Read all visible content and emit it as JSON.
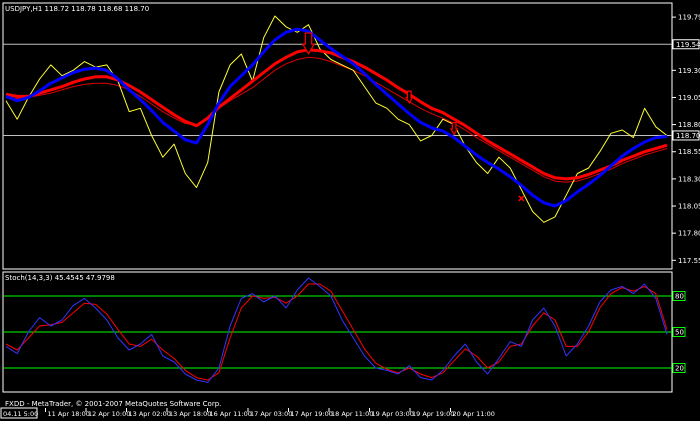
{
  "app": {
    "footer_text": "FXDD - MetaTrader, © 2001-2007 MetaQuotes Software Corp."
  },
  "colors": {
    "background": "#000000",
    "frame": "#FFFFFF",
    "grid": "#C0C0C0",
    "price": "#FFFF33",
    "ema_fast": "#0000FF",
    "ema_slow": "#FF0000",
    "signal_thin": "#DD0000",
    "stoch_main": "#3333FF",
    "stoch_signal": "#FF0000",
    "level_line": "#00FF00"
  },
  "price_chart": {
    "header": "USDJPY,H1  118.72 118.78 118.68 118.70",
    "y_ticks": [
      "119.79",
      "119.54",
      "119.30",
      "119.05",
      "118.80",
      "118.55",
      "118.30",
      "118.05",
      "117.80",
      "117.55"
    ],
    "highlight_levels": [
      "119.54",
      "118.70"
    ],
    "markers": [
      {
        "icon": "down-arrow-icon",
        "size": "large"
      },
      {
        "icon": "down-arrow-icon",
        "size": "small"
      },
      {
        "icon": "down-arrow-icon",
        "size": "small"
      },
      {
        "icon": "cross-icon",
        "size": "small"
      }
    ]
  },
  "stoch_chart": {
    "header": "Stoch(14,3,3) 45.4545 47.9798",
    "levels": [
      "80",
      "50",
      "20"
    ]
  },
  "time_axis": [
    "04.11 5:00",
    "11 Apr 18:00",
    "12 Apr 10:00",
    "13 Apr 02:00",
    "13 Apr 18:00",
    "16 Apr 11:00",
    "17 Apr 03:00",
    "17 Apr 19:00",
    "18 Apr 11:00",
    "19 Apr 03:00",
    "19 Apr 19:00",
    "20 Apr 11:00"
  ],
  "chart_data": {
    "type": "line",
    "symbol": "USDJPY",
    "timeframe": "H1",
    "last_bar": {
      "open": 118.72,
      "high": 118.78,
      "low": 118.68,
      "close": 118.7
    },
    "ylim": [
      117.47,
      119.92
    ],
    "series": [
      {
        "values": [
          119.02,
          118.85,
          119.05,
          119.22,
          119.35,
          119.25,
          119.3,
          119.38,
          119.33,
          119.35,
          119.2,
          118.92,
          118.95,
          118.7,
          118.5,
          118.62,
          118.35,
          118.22,
          118.45,
          119.1,
          119.35,
          119.45,
          119.2,
          119.6,
          119.8,
          119.7,
          119.65,
          119.72,
          119.5,
          119.4,
          119.35,
          119.3,
          119.15,
          119.0,
          118.95,
          118.85,
          118.8,
          118.65,
          118.7,
          118.85,
          118.8,
          118.6,
          118.45,
          118.35,
          118.5,
          118.4,
          118.2,
          118.0,
          117.9,
          117.95,
          118.15,
          118.35,
          118.4,
          118.55,
          118.72,
          118.75,
          118.68,
          118.95,
          118.78,
          118.7
        ]
      },
      {
        "values": [
          119.06,
          119.02,
          119.05,
          119.11,
          119.18,
          119.23,
          119.28,
          119.31,
          119.32,
          119.3,
          119.22,
          119.12,
          119.03,
          118.93,
          118.82,
          118.74,
          118.66,
          118.63,
          118.8,
          119.0,
          119.15,
          119.25,
          119.35,
          119.47,
          119.58,
          119.65,
          119.68,
          119.66,
          119.58,
          119.5,
          119.43,
          119.36,
          119.27,
          119.17,
          119.08,
          118.99,
          118.9,
          118.82,
          118.77,
          118.74,
          118.68,
          118.6,
          118.52,
          118.45,
          118.39,
          118.32,
          118.24,
          118.15,
          118.08,
          118.05,
          118.1,
          118.18,
          118.25,
          118.33,
          118.42,
          118.51,
          118.58,
          118.64,
          118.68,
          118.69
        ]
      },
      {
        "values": [
          119.08,
          119.06,
          119.06,
          119.09,
          119.12,
          119.15,
          119.19,
          119.22,
          119.24,
          119.24,
          119.21,
          119.16,
          119.1,
          119.03,
          118.96,
          118.89,
          118.83,
          118.79,
          118.86,
          118.96,
          119.04,
          119.12,
          119.2,
          119.28,
          119.36,
          119.42,
          119.47,
          119.49,
          119.48,
          119.46,
          119.42,
          119.38,
          119.33,
          119.27,
          119.21,
          119.14,
          119.08,
          119.01,
          118.95,
          118.91,
          118.85,
          118.79,
          118.72,
          118.65,
          118.59,
          118.53,
          118.47,
          118.41,
          118.35,
          118.31,
          118.3,
          118.31,
          118.34,
          118.38,
          118.42,
          118.47,
          118.51,
          118.55,
          118.58,
          118.61
        ]
      },
      {
        "values": [
          119.05,
          119.04,
          119.05,
          119.07,
          119.09,
          119.12,
          119.15,
          119.17,
          119.18,
          119.18,
          119.16,
          119.12,
          119.06,
          118.99,
          118.92,
          118.86,
          118.81,
          118.8,
          118.86,
          118.95,
          119.02,
          119.08,
          119.14,
          119.22,
          119.3,
          119.36,
          119.4,
          119.42,
          119.41,
          119.38,
          119.34,
          119.3,
          119.25,
          119.19,
          119.13,
          119.07,
          119.01,
          118.95,
          118.9,
          118.86,
          118.81,
          118.75,
          118.68,
          118.62,
          118.56,
          118.5,
          118.44,
          118.38,
          118.32,
          118.28,
          118.27,
          118.28,
          118.31,
          118.35,
          118.39,
          118.44,
          118.48,
          118.52,
          118.55,
          118.58
        ]
      },
      {
        "values": [
          38,
          32,
          50,
          62,
          55,
          60,
          72,
          78,
          70,
          60,
          45,
          35,
          40,
          48,
          30,
          25,
          15,
          10,
          8,
          20,
          55,
          78,
          82,
          75,
          80,
          70,
          85,
          95,
          88,
          80,
          60,
          45,
          30,
          20,
          18,
          15,
          22,
          12,
          10,
          18,
          30,
          40,
          25,
          15,
          28,
          42,
          38,
          60,
          70,
          55,
          30,
          40,
          55,
          75,
          85,
          88,
          82,
          90,
          78,
          48
        ]
      },
      {
        "values": [
          40,
          35,
          45,
          55,
          56,
          58,
          66,
          74,
          73,
          65,
          52,
          40,
          38,
          44,
          35,
          28,
          18,
          12,
          10,
          16,
          45,
          70,
          80,
          78,
          79,
          74,
          80,
          90,
          90,
          84,
          68,
          52,
          36,
          24,
          19,
          16,
          20,
          15,
          12,
          16,
          26,
          36,
          30,
          20,
          25,
          38,
          40,
          55,
          66,
          60,
          38,
          38,
          50,
          70,
          82,
          87,
          84,
          88,
          82,
          52
        ]
      }
    ]
  }
}
